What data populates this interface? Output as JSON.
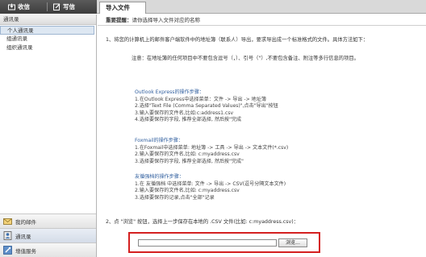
{
  "topbar": {
    "inbox_label": "收信",
    "compose_label": "写信",
    "active_tab": "导入文件"
  },
  "sidebar": {
    "header": "通讯录",
    "items": [
      {
        "label": "个人通讯录"
      },
      {
        "label": "组通讯录"
      },
      {
        "label": "组织通讯录"
      }
    ],
    "bottom": [
      {
        "label": "我的邮件",
        "icon": "envelope-icon"
      },
      {
        "label": "通讯录",
        "icon": "contacts-icon"
      },
      {
        "label": "增值服务",
        "icon": "tools-icon"
      }
    ]
  },
  "main": {
    "notice_label": "重要提醒：",
    "notice_text": "请你选择导入文件对应的名称",
    "step1": "1、将您的计算机上的邮件客户端软件中的地址簿（联系人）导出，要求导出成一个标准格式的文件。具体方法如下：",
    "note": "注意：在地址簿的任何项目中不要包含逗号（，）、引号（\"）,不要包含备注、附注等多行信息的项目。",
    "outlook": {
      "title": "Outlook Express的操作步骤：",
      "lines": [
        "1.在Outlook Express中选择菜单：文件 -> 导出 -> 地址簿",
        "2.选择\"Text File (Comma Separated Values)\",点击\"导出\"按钮",
        "3.输入要保存的文件名,比如:c:address1.csv",
        "4.选择要保存的字段, 推荐全部选择, 然后按\"完成"
      ]
    },
    "foxmail": {
      "title": "Foxmail的操作步骤：",
      "lines": [
        "1.在Foxmail中选择菜单: 地址簿 -> 工具 -> 导出 -> 文本文件(*.csv)",
        "2.输入要保存的文件名,比如: c:myaddress.csv",
        "3.选择要保存的字段, 推荐全部选择, 然后按\"完成\""
      ]
    },
    "other": {
      "title": "友循强档的操作步骤：",
      "lines": [
        "1.在 友循强档 中选择菜单: 文件 -> 导出 -> CSV(逗号分隔文本文件)",
        "2.输入要保存的文件名,比如: c:myaddress.csv",
        "3.选择要保存的记录,点击\"全部\"记录"
      ]
    },
    "step2": "2、点 \"浏览\" 按钮，选择上一步保存在本地的 .CSV 文件(比如: c:myaddress.csv)：",
    "file_input_value": "",
    "browse_label": "浏览..."
  },
  "colors": {
    "accent": "#d42020",
    "link_blue": "#2f5e9e",
    "topbar_dark": "#3d3d3d"
  }
}
